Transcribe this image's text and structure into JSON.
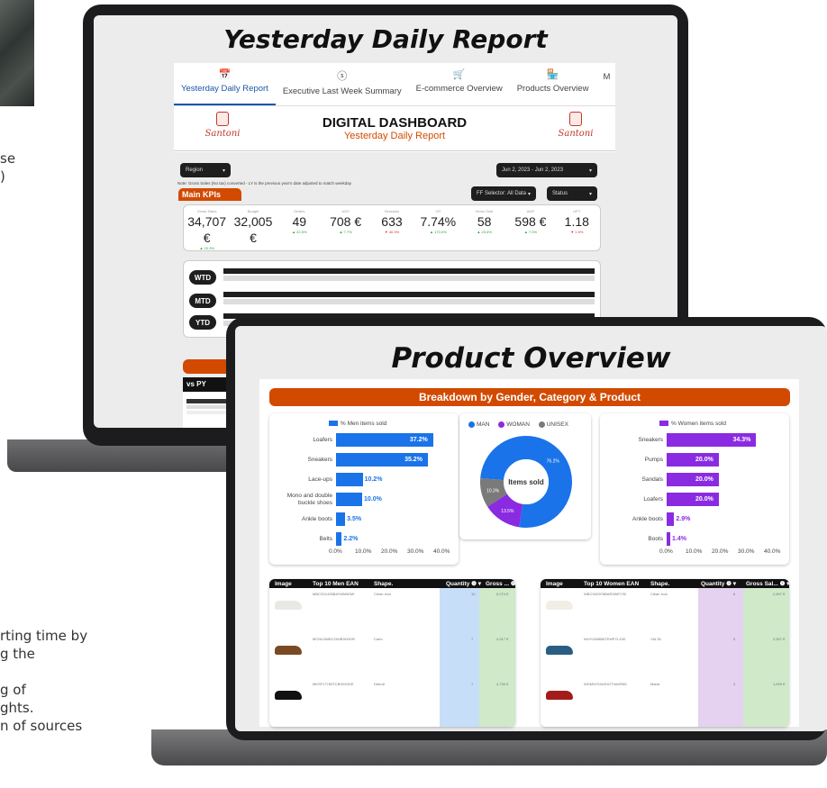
{
  "left_text": {
    "line1": "se",
    "line2": ")",
    "line3": "rting time by",
    "line4": "g the",
    "line5": "g of",
    "line6": "ghts.",
    "line7": "n of sources"
  },
  "laptop1": {
    "heading": "Yesterday Daily Report",
    "tabs": [
      {
        "icon": "📅",
        "label": "Yesterday Daily Report"
      },
      {
        "icon": "ⓢ",
        "label": "Executive Last Week Summary"
      },
      {
        "icon": "🛒",
        "label": "E-commerce Overview"
      },
      {
        "icon": "🏪",
        "label": "Products Overview"
      },
      {
        "icon": "",
        "label": "M"
      }
    ],
    "header": {
      "title": "DIGITAL DASHBOARD",
      "subtitle": "Yesterday Daily Report",
      "brand": "Santoni"
    },
    "region_label": "Region",
    "date_range": "Jun 2, 2023 - Jun 2, 2023",
    "note": "Note: Gross Sales (No tax) converted - LY is the previous year's date adjusted to match weekday",
    "ff_selector": "FF Selector: All Data",
    "status_label": "Status",
    "main_kpis_label": "Main KPIs",
    "kpis": [
      {
        "label": "Gross Sales",
        "value": "34,707 €",
        "delta": "▲ 20.3%"
      },
      {
        "label": "Budget",
        "value": "32,005 €",
        "delta": ""
      },
      {
        "label": "Orders",
        "value": "49",
        "delta": "▲ 22.5%"
      },
      {
        "label": "AOV",
        "value": "708 €",
        "delta": "▲ 7.7%"
      },
      {
        "label": "Sessions",
        "value": "633",
        "delta": "▼ 40.3%"
      },
      {
        "label": "CR",
        "value": "7.74%",
        "delta": "▲ 173.0%"
      },
      {
        "label": "Items Sold",
        "value": "58",
        "delta": "▲ 23.4%"
      },
      {
        "label": "AUR",
        "value": "598 €",
        "delta": "▲ 7.0%"
      },
      {
        "label": "UPT",
        "value": "1.18",
        "delta": "▼ 1.5%"
      }
    ],
    "periods": [
      "WTD",
      "MTD",
      "YTD"
    ],
    "vs_py": "vs PY"
  },
  "laptop2": {
    "heading": "Product Overview",
    "banner": "Breakdown by Gender, Category & Product",
    "men_chart": {
      "legend": "% Men items sold",
      "color": "#1a73e8",
      "categories": [
        "Loafers",
        "Sneakers",
        "Lace-ups",
        "Mono and double buckle shoes",
        "Ankle boots",
        "Belts"
      ],
      "values": [
        37.2,
        35.2,
        10.2,
        10.0,
        3.5,
        2.2
      ],
      "labels": [
        "37.2%",
        "35.2%",
        "10.2%",
        "10.0%",
        "3.5%",
        "2.2%"
      ],
      "ticks": [
        "0.0%",
        "10.0%",
        "20.0%",
        "30.0%",
        "40.0%"
      ],
      "max": 40
    },
    "donut": {
      "legend": [
        {
          "name": "MAN",
          "color": "#1a73e8"
        },
        {
          "name": "WOMAN",
          "color": "#8a2be2"
        },
        {
          "name": "UNISEX",
          "color": "#7a7a7a"
        }
      ],
      "center_label": "Items sold",
      "values": [
        76.2,
        13.5,
        10.3
      ],
      "labels": [
        "76.2%",
        "13.5%",
        "10.3%"
      ]
    },
    "women_chart": {
      "legend": "% Women items sold",
      "color": "#8a2be2",
      "categories": [
        "Sneakers",
        "Pumps",
        "Sandals",
        "Loafers",
        "Ankle boots",
        "Boots"
      ],
      "values": [
        34.3,
        20.0,
        20.0,
        20.0,
        2.9,
        1.4
      ],
      "labels": [
        "34.3%",
        "20.0%",
        "20.0%",
        "20.0%",
        "2.9%",
        "1.4%"
      ],
      "ticks": [
        "0.0%",
        "10.0%",
        "20.0%",
        "30.0%",
        "40.0%"
      ],
      "max": 40
    },
    "men_table": {
      "headers": [
        "Image",
        "Top 10 Men EAN",
        "Shape.",
        "Quantity ❶ ▾",
        "Gross ... ❶ ▾"
      ],
      "rows": [
        {
          "ean": "MBCS21435BAYWMN3W",
          "shape": "Clean Icon",
          "qty": "10",
          "gross": "6,074 €"
        },
        {
          "ean": "MCNU18801TAHB3H4OR",
          "shape": "Carlo",
          "qty": "7",
          "gross": "4,917 €"
        },
        {
          "ean": "MKSF17783TCBGEIGKE",
          "shape": "Detroit",
          "qty": "7",
          "gross": "4,736 €"
        }
      ]
    },
    "women_table": {
      "headers": [
        "Image",
        "Top 10 Women EAN",
        "Shape.",
        "Quantity ❶ ▾",
        "Gross Sal... ❶ ▾"
      ],
      "rows": [
        {
          "ean": "WBCS40978BAR3WEY30",
          "shape": "Clean Icon",
          "qty": "6",
          "gross": "2,897 €"
        },
        {
          "ean": "WUYU58856TEMPYLZ40",
          "shape": "YALTA",
          "qty": "5",
          "gross": "2,557 €"
        },
        {
          "ean": "WDMN70342HOTVAHR80",
          "shape": "Marta",
          "qty": "3",
          "gross": "1,699 €"
        }
      ]
    }
  }
}
